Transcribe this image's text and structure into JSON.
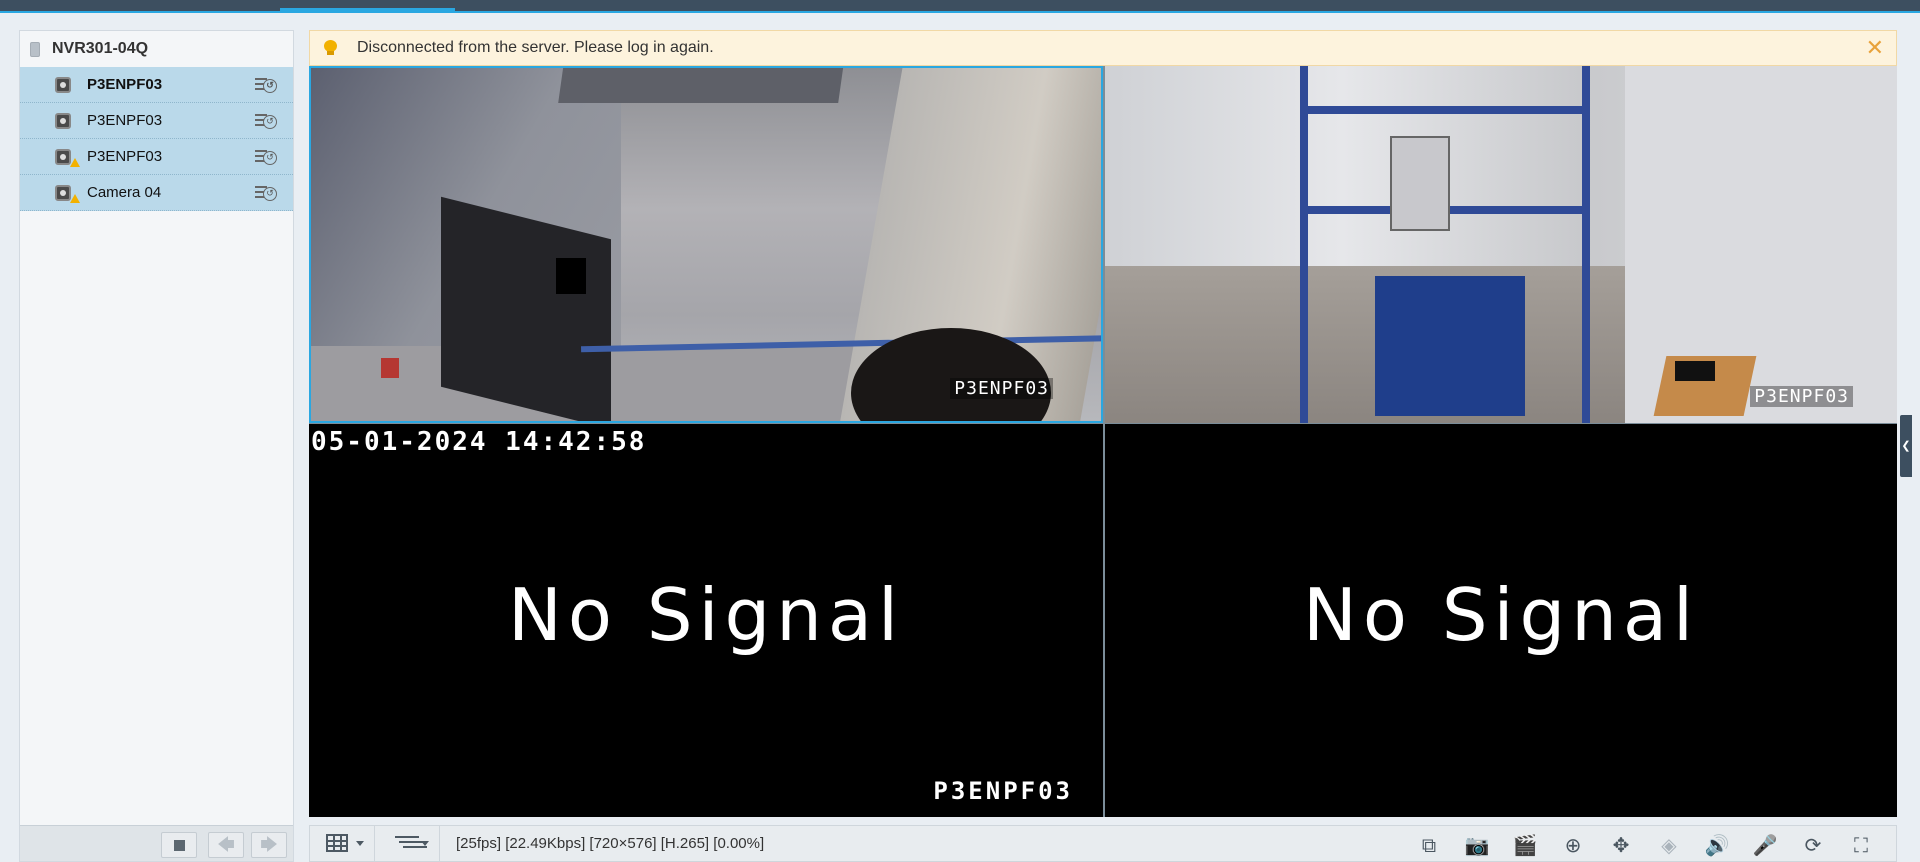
{
  "sidebar": {
    "device_name": "NVR301-04Q",
    "cameras": [
      {
        "label": "P3ENPF03",
        "selected": true,
        "warning": false
      },
      {
        "label": "P3ENPF03",
        "selected": false,
        "warning": false
      },
      {
        "label": "P3ENPF03",
        "selected": false,
        "warning": true
      },
      {
        "label": "Camera 04",
        "selected": false,
        "warning": true
      }
    ]
  },
  "banner": {
    "message": "Disconnected from the server. Please log in again.",
    "close_glyph": "✕"
  },
  "tiles": [
    {
      "osd_name": "P3ENPF03",
      "state": "live"
    },
    {
      "osd_name": "P3ENPF03",
      "state": "live"
    },
    {
      "osd_time": "05-01-2024 14:42:58",
      "message": "No Signal",
      "osd_name": "P3ENPF03",
      "state": "no-signal"
    },
    {
      "message": "No Signal",
      "state": "no-signal"
    }
  ],
  "toolbar": {
    "stats": "[25fps] [22.49Kbps] [720×576] [H.265] [0.00%]",
    "icons": [
      "window-layout-icon",
      "stream-icon",
      "snapshot-window-icon",
      "camera-snapshot-icon",
      "clip-icon",
      "digital-zoom-icon",
      "ptz-icon",
      "focus-icon",
      "volume-icon",
      "talk-icon",
      "3d-zoom-icon",
      "fullscreen-icon"
    ]
  },
  "colors": {
    "accent": "#2aa7e1",
    "selected_row": "#bad9ea",
    "banner_bg": "#fdf3dd",
    "warning": "#f2b100"
  }
}
